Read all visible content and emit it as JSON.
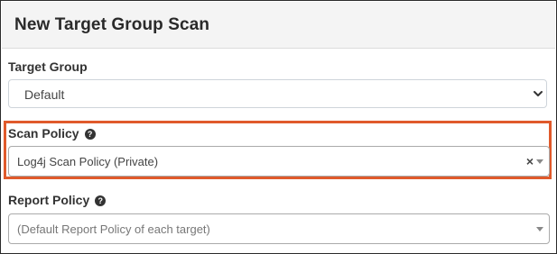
{
  "modal": {
    "title": "New Target Group Scan"
  },
  "target_group": {
    "label": "Target Group",
    "selected": "Default",
    "icon": "chevron-down-icon"
  },
  "scan_policy": {
    "label": "Scan Policy",
    "help_icon_glyph": "?",
    "selected": "Log4j Scan Policy (Private)",
    "clear_glyph": "×",
    "highlight_color": "#e05a2b"
  },
  "report_policy": {
    "label": "Report Policy",
    "help_icon_glyph": "?",
    "placeholder": "(Default Report Policy of each target)"
  }
}
